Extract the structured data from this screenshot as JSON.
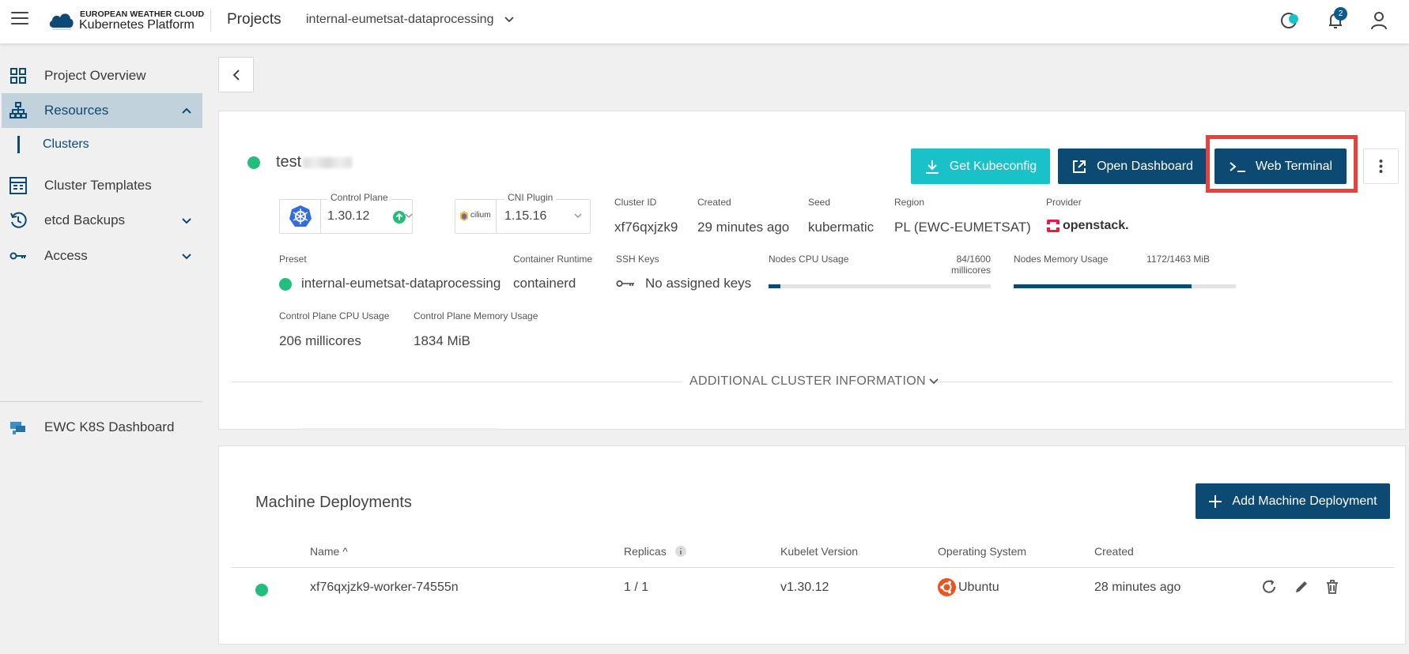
{
  "header": {
    "brand_line1": "EUROPEAN WEATHER CLOUD",
    "brand_line2": "Kubernetes Platform",
    "projects_label": "Projects",
    "project_name": "internal-eumetsat-dataprocessing",
    "notification_count": "2"
  },
  "sidebar": {
    "items": [
      {
        "label": "Project Overview",
        "icon": "grid-icon"
      },
      {
        "label": "Resources",
        "icon": "sitemap-icon"
      },
      {
        "label": "Cluster Templates",
        "icon": "template-icon"
      },
      {
        "label": "etcd Backups",
        "icon": "backup-history-icon"
      },
      {
        "label": "Access",
        "icon": "key-icon"
      }
    ],
    "sub_item": "Clusters",
    "dashboard_link": "EWC K8S Dashboard"
  },
  "cluster": {
    "name": "test",
    "buttons": {
      "kubeconfig": "Get Kubeconfig",
      "dashboard": "Open Dashboard",
      "terminal": "Web Terminal"
    },
    "control_plane": {
      "label": "Control Plane",
      "version": "1.30.12"
    },
    "cni_plugin": {
      "label": "CNI Plugin",
      "logo_text": "cilium",
      "version": "1.15.16"
    },
    "cluster_id": {
      "label": "Cluster ID",
      "value": "xf76qxjzk9"
    },
    "created": {
      "label": "Created",
      "value": "29 minutes ago"
    },
    "seed": {
      "label": "Seed",
      "value": "kubermatic"
    },
    "region": {
      "label": "Region",
      "value": "PL (EWC-EUMETSAT)"
    },
    "provider": {
      "label": "Provider",
      "value": "openstack."
    },
    "preset": {
      "label": "Preset",
      "value": "internal-eumetsat-dataprocessing"
    },
    "container_runtime": {
      "label": "Container Runtime",
      "value": "containerd"
    },
    "ssh_keys": {
      "label": "SSH Keys",
      "value": "No assigned keys"
    },
    "nodes_cpu": {
      "label": "Nodes CPU Usage",
      "value": "84/1600 millicores",
      "fraction": 0.0525
    },
    "nodes_memory": {
      "label": "Nodes Memory Usage",
      "value": "1172/1463 MiB",
      "fraction": 0.801
    },
    "cp_cpu": {
      "label": "Control Plane CPU Usage",
      "value": "206 millicores"
    },
    "cp_memory": {
      "label": "Control Plane Memory Usage",
      "value": "1834 MiB"
    },
    "additional_info": "ADDITIONAL CLUSTER INFORMATION"
  },
  "machine_deployments": {
    "title": "Machine Deployments",
    "add_button": "Add Machine Deployment",
    "columns": [
      "Name",
      "Replicas",
      "Kubelet Version",
      "Operating System",
      "Created"
    ],
    "name_sort_indicator": "^",
    "rows": [
      {
        "name": "xf76qxjzk9-worker-74555n",
        "replicas": "1 / 1",
        "kubelet": "v1.30.12",
        "os": "Ubuntu",
        "created": "28 minutes ago"
      }
    ]
  },
  "colors": {
    "primary": "#0d4a73",
    "accent": "#19c2c9",
    "status_ok": "#23be7c",
    "highlight": "#e8403a"
  }
}
